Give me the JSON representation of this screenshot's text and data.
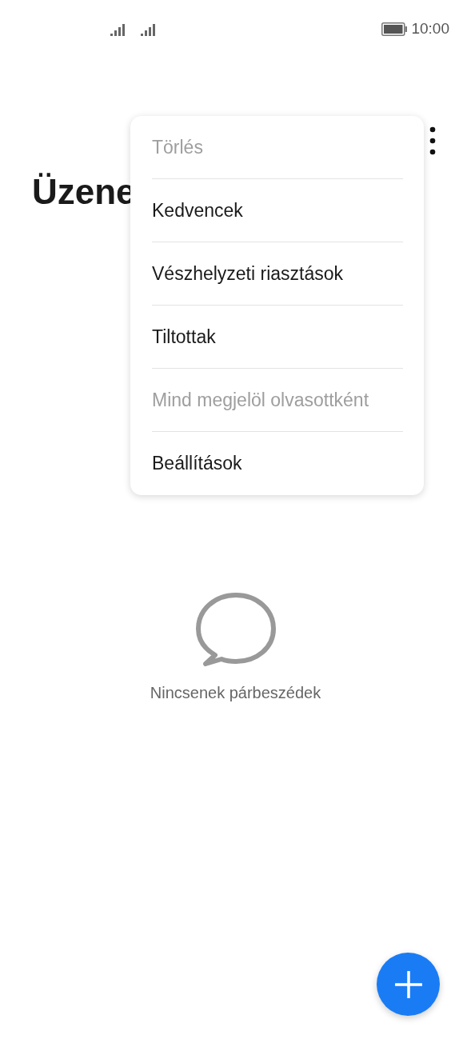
{
  "status_bar": {
    "time": "10:00"
  },
  "title": "Üzene",
  "menu": {
    "items": [
      {
        "label": "Törlés",
        "disabled": true
      },
      {
        "label": "Kedvencek",
        "disabled": false
      },
      {
        "label": "Vészhelyzeti riasztások",
        "disabled": false
      },
      {
        "label": "Tiltottak",
        "disabled": false
      },
      {
        "label": "Mind megjelöl olvasottként",
        "disabled": true
      },
      {
        "label": "Beállítások",
        "disabled": false
      }
    ]
  },
  "empty_state": {
    "message": "Nincsenek párbeszédek"
  }
}
